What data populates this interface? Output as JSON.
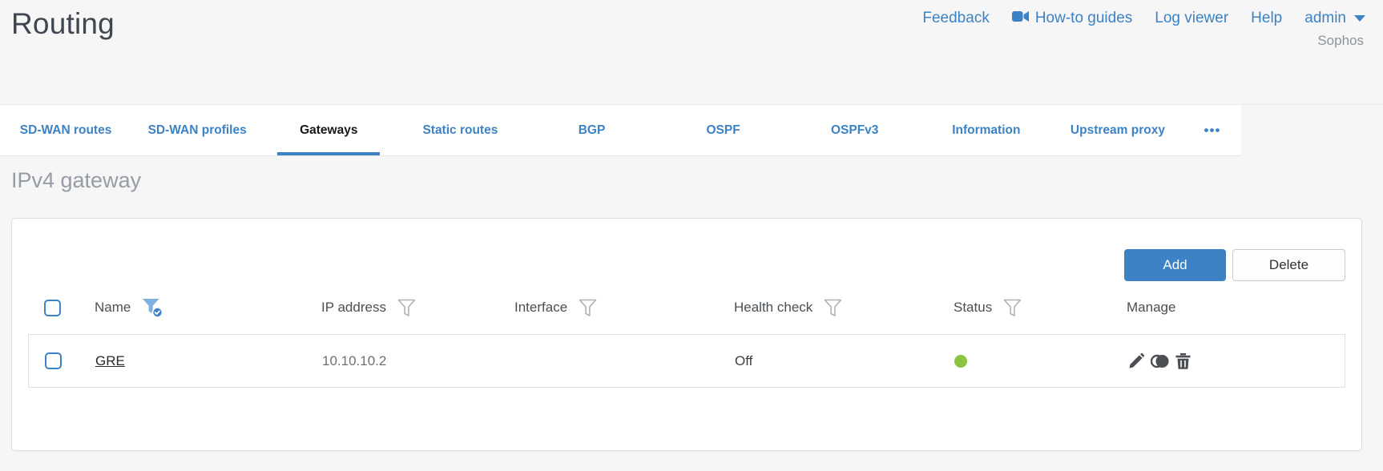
{
  "page": {
    "title": "Routing"
  },
  "header": {
    "brand": "Sophos",
    "links": [
      {
        "label": "Feedback"
      },
      {
        "label": "How-to guides",
        "icon": "video-camera-icon"
      },
      {
        "label": "Log viewer"
      },
      {
        "label": "Help"
      },
      {
        "label": "admin",
        "icon": "caret-down-icon"
      }
    ]
  },
  "tabs": {
    "items": [
      {
        "label": "SD-WAN routes",
        "active": false
      },
      {
        "label": "SD-WAN profiles",
        "active": false
      },
      {
        "label": "Gateways",
        "active": true
      },
      {
        "label": "Static routes",
        "active": false
      },
      {
        "label": "BGP",
        "active": false
      },
      {
        "label": "OSPF",
        "active": false
      },
      {
        "label": "OSPFv3",
        "active": false
      },
      {
        "label": "Information",
        "active": false
      },
      {
        "label": "Upstream proxy",
        "active": false
      }
    ],
    "overflow_label": "•••"
  },
  "main": {
    "section_title": "IPv4 gateway",
    "actions": {
      "add_label": "Add",
      "delete_label": "Delete"
    }
  },
  "table": {
    "columns": [
      {
        "label": "Name",
        "filter": "active"
      },
      {
        "label": "IP address",
        "filter": "inactive"
      },
      {
        "label": "Interface",
        "filter": "inactive"
      },
      {
        "label": "Health check",
        "filter": "inactive"
      },
      {
        "label": "Status",
        "filter": "inactive"
      },
      {
        "label": "Manage",
        "filter": "none"
      }
    ],
    "rows": [
      {
        "name": "GRE",
        "ip_address": "10.10.10.2",
        "interface": "",
        "health_check": "Off",
        "status": "up",
        "manage": [
          "edit",
          "clone",
          "delete"
        ]
      }
    ]
  },
  "colors": {
    "accent_blue": "#3c82c4",
    "status_up_green": "#8bc53f",
    "panel_background": "#ffffff",
    "page_background": "#f6f6f7"
  }
}
